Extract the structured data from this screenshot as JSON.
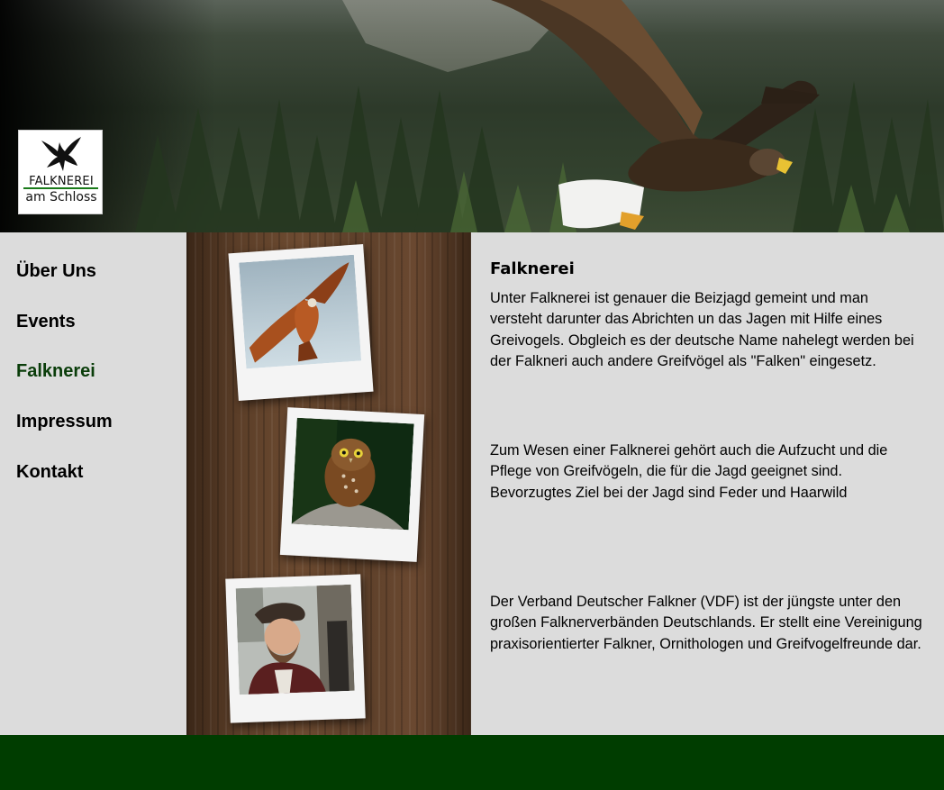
{
  "logo": {
    "line1": "FALKNEREI",
    "line2": "am Schloss"
  },
  "nav": {
    "items": [
      {
        "label": "Über Uns"
      },
      {
        "label": "Events"
      },
      {
        "label": "Falknerei",
        "active": true
      },
      {
        "label": "Impressum"
      },
      {
        "label": "Kontakt"
      }
    ]
  },
  "content": {
    "title": "Falknerei",
    "paragraphs": [
      "Unter Falknerei ist genauer die Beizjagd gemeint und man versteht darunter das Abrichten un das Jagen mit Hilfe eines Greivogels. Obgleich es der deutsche Name nahelegt werden bei der Falkneri auch andere Greifvögel als \"Falken\" eingesetz.",
      "Zum Wesen einer Falknerei gehört auch die Aufzucht und die Pflege von Greifvögeln, die für die Jagd geeignet sind. Bevorzugtes Ziel bei der Jagd sind Feder und Haarwild",
      "Der Verband Deutscher Falkner (VDF) ist der jüngste unter den großen Falknerverbänden Deutschlands. Er stellt eine Vereinigung praxisorientierter Falkner, Ornithologen und Greifvogelfreunde dar."
    ]
  },
  "colors": {
    "footer": "#003d00",
    "active_nav": "#0a3d0a",
    "background": "#dcdcdc"
  },
  "icons": {
    "logo": "eagle-logo-icon",
    "photo1": "red-kite-photo",
    "photo2": "owl-photo",
    "photo3": "falconer-photo"
  }
}
